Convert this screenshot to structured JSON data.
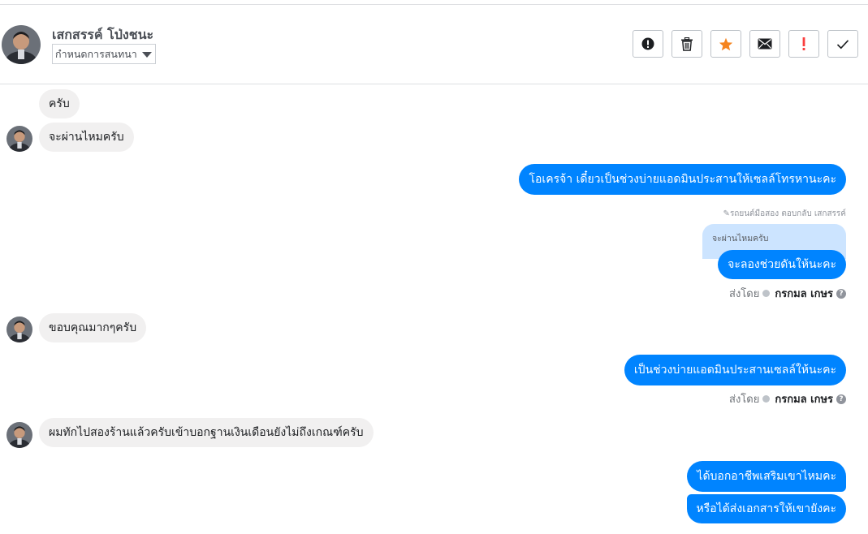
{
  "header": {
    "name": "เสกสรรค์ โป่งชนะ",
    "assign_label": "กำหนดการสนทนา",
    "actions": [
      "spam-icon",
      "trash-icon",
      "star-icon",
      "envelope-icon",
      "exclamation-icon",
      "check-icon"
    ]
  },
  "messages": {
    "m1": "ครับ",
    "m2": "จะผ่านไหมครับ",
    "m3": "โอเครจ้า เดี๋ยวเป็นช่วงบ่ายแอดมินประสานให้เซลล์โทรหานะคะ",
    "reply_meta": "รถยนต์มือสอง ตอบกลับ เสกสรรค์",
    "quoted": "จะผ่านไหมครับ",
    "m4": "จะลองช่วยดันให้นะคะ",
    "m5": "ขอบคุณมากๆครับ",
    "m6": "เป็นช่วงบ่ายแอดมินประสานเซลล์ให้นะคะ",
    "m7": "ผมทักไปสองร้านแล้วครับเข้าบอกฐานเงินเดือนยังไม่ถึงเกณฑ์ครับ",
    "m8": "ได้บอกอาชีพเสริมเขาไหมคะ",
    "m9": "หรือได้ส่งเอกสารให้เขายังคะ"
  },
  "sent_by": {
    "prefix": "ส่งโดย",
    "name": "กรกมล เกษร",
    "help": "?"
  },
  "colors": {
    "outgoing": "#0084ff",
    "incoming": "#f1f0f0",
    "star": "#f5841f",
    "exclaim": "#fa3e3e"
  }
}
